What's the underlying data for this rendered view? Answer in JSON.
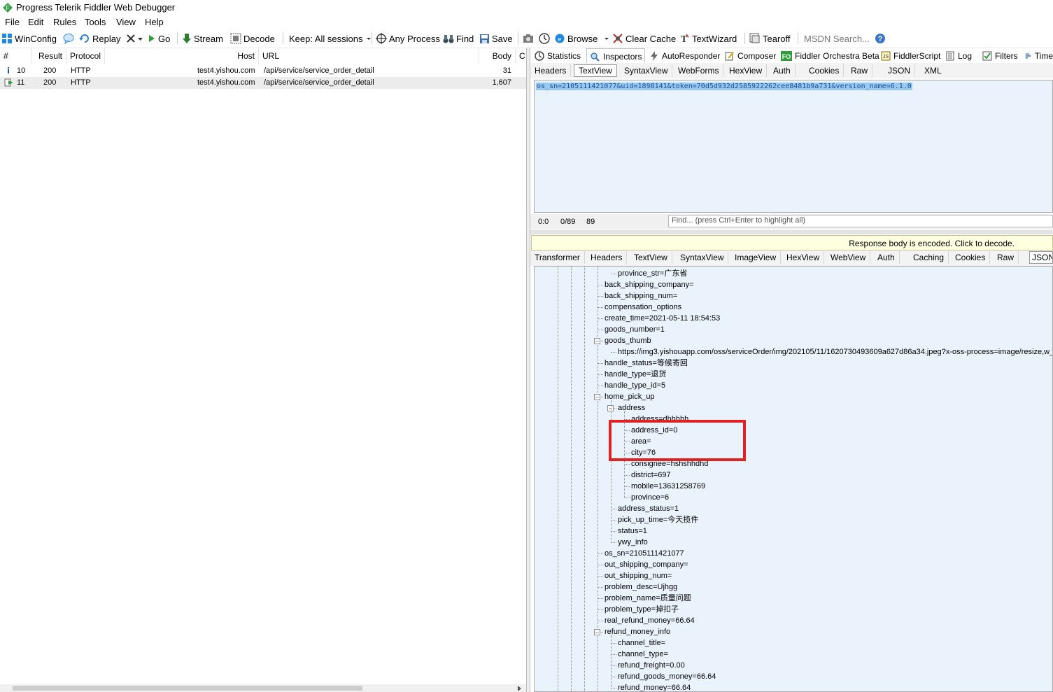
{
  "window": {
    "title": "Progress Telerik Fiddler Web Debugger"
  },
  "menu": [
    "File",
    "Edit",
    "Rules",
    "Tools",
    "View",
    "Help"
  ],
  "toolbar": {
    "winconfig": "WinConfig",
    "replay": "Replay",
    "go": "Go",
    "stream": "Stream",
    "decode": "Decode",
    "keep": "Keep: All sessions",
    "any_process": "Any Process",
    "find": "Find",
    "save": "Save",
    "browse": "Browse",
    "clear_cache": "Clear Cache",
    "textwizard": "TextWizard",
    "tearoff": "Tearoff",
    "msdn_search": "MSDN Search..."
  },
  "sessions": {
    "columns": [
      "#",
      "Result",
      "Protocol",
      "Host",
      "URL",
      "Body",
      "C"
    ],
    "rows": [
      {
        "num": "10",
        "result": "200",
        "protocol": "HTTP",
        "host": "test4.yishou.com",
        "url": "/api/service/service_order_detail",
        "body": "31"
      },
      {
        "num": "11",
        "result": "200",
        "protocol": "HTTP",
        "host": "test4.yishou.com",
        "url": "/api/service/service_order_detail",
        "body": "1,607"
      }
    ]
  },
  "top_tabs": [
    "Statistics",
    "Inspectors",
    "AutoResponder",
    "Composer",
    "Fiddler Orchestra Beta",
    "FiddlerScript",
    "Log",
    "Filters",
    "Time"
  ],
  "request_tabs": [
    "Headers",
    "TextView",
    "SyntaxView",
    "WebForms",
    "HexView",
    "Auth",
    "Cookies",
    "Raw",
    "JSON",
    "XML"
  ],
  "request_text": "os_sn=2105111421077&uid=1898141&token=70d5d932d2585922262cee8481b9a731&version_name=6.1.0",
  "status": {
    "pos": "0:0",
    "sel": "0/89",
    "len": "89",
    "find_placeholder": "Find... (press Ctrl+Enter to highlight all)"
  },
  "notice": "Response body is encoded. Click to decode.",
  "response_tabs": [
    "Transformer",
    "Headers",
    "TextView",
    "SyntaxView",
    "ImageView",
    "HexView",
    "WebView",
    "Auth",
    "Caching",
    "Cookies",
    "Raw",
    "JSON"
  ],
  "tree": [
    {
      "text": "province_str=广东省",
      "level": 2
    },
    {
      "text": "back_shipping_company=",
      "level": 1
    },
    {
      "text": "back_shipping_num=",
      "level": 1
    },
    {
      "text": "compensation_options",
      "level": 1
    },
    {
      "text": "create_time=2021-05-11 18:54:53",
      "level": 1
    },
    {
      "text": "goods_number=1",
      "level": 1
    },
    {
      "text": "goods_thumb",
      "level": 1,
      "expander": true
    },
    {
      "text": "https://img3.yishouapp.com/oss/serviceOrder/img/202105/11/1620730493609a627d86a34.jpeg?x-oss-process=image/resize,w_",
      "level": 2
    },
    {
      "text": "handle_status=等候寄回",
      "level": 1
    },
    {
      "text": "handle_type=退货",
      "level": 1
    },
    {
      "text": "handle_type_id=5",
      "level": 1
    },
    {
      "text": "home_pick_up",
      "level": 1,
      "expander": true
    },
    {
      "text": "address",
      "level": 2,
      "expander": true
    },
    {
      "text": "address=dhhhhh",
      "level": 3
    },
    {
      "text": "address_id=0",
      "level": 3
    },
    {
      "text": "area=",
      "level": 3
    },
    {
      "text": "city=76",
      "level": 3
    },
    {
      "text": "consignee=hshshhdhd",
      "level": 3
    },
    {
      "text": "district=697",
      "level": 3
    },
    {
      "text": "mobile=13631258769",
      "level": 3
    },
    {
      "text": "province=6",
      "level": 3
    },
    {
      "text": "address_status=1",
      "level": 2
    },
    {
      "text": "pick_up_time=今天揽件",
      "level": 2
    },
    {
      "text": "status=1",
      "level": 2
    },
    {
      "text": "ywy_info",
      "level": 2
    },
    {
      "text": "os_sn=2105111421077",
      "level": 1
    },
    {
      "text": "out_shipping_company=",
      "level": 1
    },
    {
      "text": "out_shipping_num=",
      "level": 1
    },
    {
      "text": "problem_desc=Ujhgg",
      "level": 1
    },
    {
      "text": "problem_name=质量问题",
      "level": 1
    },
    {
      "text": "problem_type=掉扣子",
      "level": 1
    },
    {
      "text": "real_refund_money=66.64",
      "level": 1
    },
    {
      "text": "refund_money_info",
      "level": 1,
      "expander": true
    },
    {
      "text": "channel_title=",
      "level": 2
    },
    {
      "text": "channel_type=",
      "level": 2
    },
    {
      "text": "refund_freight=0.00",
      "level": 2
    },
    {
      "text": "refund_goods_money=66.64",
      "level": 2
    },
    {
      "text": "refund_money=66.64",
      "level": 2
    }
  ],
  "colors": {
    "highlight": "#e02222",
    "selected_row": "#ececec",
    "req_selection": "#99c9ef",
    "editor_bg": "#eaf3fc"
  }
}
